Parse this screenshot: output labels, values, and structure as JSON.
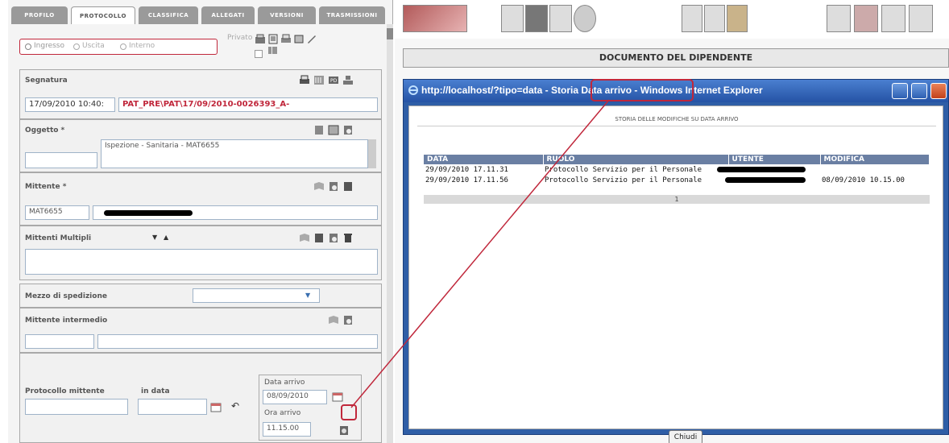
{
  "tabs": [
    {
      "label": "PROFILO"
    },
    {
      "label": "PROTOCOLLO"
    },
    {
      "label": "CLASSIFICA"
    },
    {
      "label": "ALLEGATI"
    },
    {
      "label": "VERSIONI"
    },
    {
      "label": "TRASMISSIONI"
    }
  ],
  "direction": {
    "options": [
      "Ingresso",
      "Uscita",
      "Interno"
    ],
    "selected": "Ingresso",
    "private_label": "Privato"
  },
  "segnatura": {
    "label": "Segnatura",
    "date": "17/09/2010 10:40:",
    "code": "PAT_PRE\\PAT\\17/09/2010-0026393_A-"
  },
  "oggetto": {
    "label": "Oggetto *",
    "code_value": "",
    "text": "Ispezione - Sanitaria - MAT6655"
  },
  "mittente": {
    "label": "Mittente *",
    "code": "MAT6655"
  },
  "mittenti_multipli": {
    "label": "Mittenti Multipli"
  },
  "mezzo": {
    "label": "Mezzo di spedizione",
    "value": ""
  },
  "intermedio": {
    "label": "Mittente intermedio"
  },
  "protocollo_mittente": {
    "label": "Protocollo mittente",
    "in_data_label": "in data"
  },
  "data_arrivo": {
    "label": "Data arrivo",
    "value": "08/09/2010"
  },
  "ora_arrivo": {
    "label": "Ora arrivo",
    "value": "11.15.00"
  },
  "document_header": "DOCUMENTO DEL DIPENDENTE",
  "popup": {
    "title_prefix": "http://localhost/?tipo=data - ",
    "title_highlight": "Storia Data arrivo",
    "title_suffix": " - Windows Internet Explorer",
    "caption": "STORIA DELLE MODIFICHE SU DATA ARRIVO",
    "columns": [
      "DATA",
      "RUOLO",
      "UTENTE",
      "MODIFICA"
    ],
    "rows": [
      {
        "data": "29/09/2010 17.11.31",
        "ruolo": "Protocollo Servizio per il Personale",
        "modifica": ""
      },
      {
        "data": "29/09/2010 17.11.56",
        "ruolo": "Protocollo Servizio per il Personale",
        "modifica": "08/09/2010 10.15.00"
      }
    ],
    "pager": "1",
    "close_label": "Chiudi"
  },
  "colors": {
    "accent": "#c0273b",
    "title_bar": "#2553a5",
    "table_header": "#6a7fa3",
    "segnatura_text": "#c0273b"
  }
}
